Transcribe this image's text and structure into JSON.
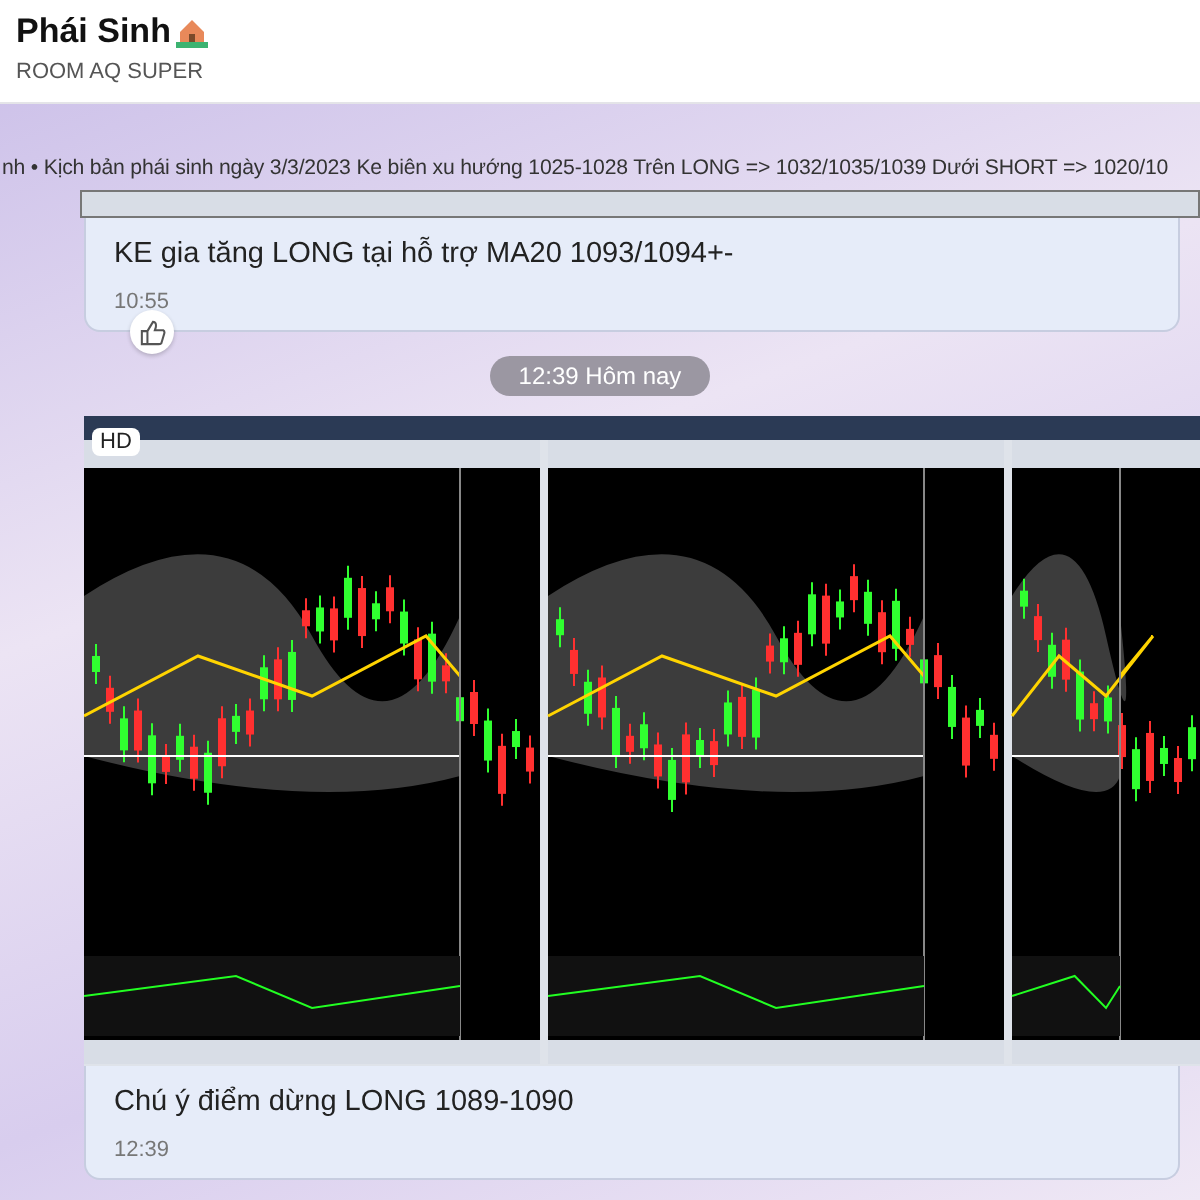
{
  "header": {
    "title": "Phái Sinh",
    "subtitle": "ROOM AQ SUPER"
  },
  "quote": {
    "text": "nh • Kịch bản phái sinh ngày 3/3/2023 Ke biên xu hướng 1025-1028 Trên LONG => 1032/1035/1039 Dưới SHORT => 1020/10"
  },
  "messages": [
    {
      "kind": "text",
      "text": "KE gia tăng LONG tại hỗ trợ MA20 1093/1094+-",
      "time": "10:55",
      "liked": true
    },
    {
      "kind": "divider",
      "text": "12:39 Hôm nay"
    },
    {
      "kind": "image",
      "badge": "HD"
    },
    {
      "kind": "text",
      "text": "Chú ý điểm dừng LONG 1089-1090",
      "time": "12:39",
      "liked": false
    }
  ]
}
